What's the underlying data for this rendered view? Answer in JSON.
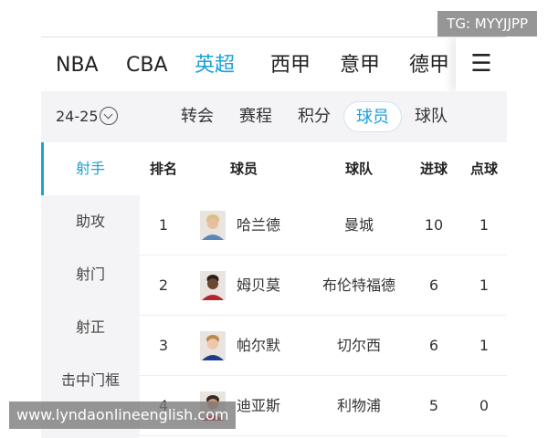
{
  "watermarks": {
    "top": "TG: MYYJJPP",
    "bottom": "www.lyndaonlineenglish.com"
  },
  "league_tabs": [
    {
      "label": "NBA"
    },
    {
      "label": "CBA"
    },
    {
      "label": "英超"
    },
    {
      "label": "西甲"
    },
    {
      "label": "意甲"
    },
    {
      "label": "德甲"
    }
  ],
  "active_league": "英超",
  "menu_icon": "hamburger-menu-icon",
  "season": {
    "label": "24-25",
    "icon": "chevron-down-circle-icon"
  },
  "sub_tabs": [
    {
      "label": "转会"
    },
    {
      "label": "赛程"
    },
    {
      "label": "积分"
    },
    {
      "label": "球员"
    },
    {
      "label": "球队"
    }
  ],
  "active_sub_tab": "球员",
  "categories": [
    {
      "label": "射手"
    },
    {
      "label": "助攻"
    },
    {
      "label": "射门"
    },
    {
      "label": "射正"
    },
    {
      "label": "击中门框"
    }
  ],
  "active_category": "射手",
  "table": {
    "headers": {
      "rank": "排名",
      "player": "球员",
      "team": "球队",
      "goals": "进球",
      "penalties": "点球"
    },
    "rows": [
      {
        "rank": "1",
        "player": "哈兰德",
        "team": "曼城",
        "goals": "10",
        "penalties": "1",
        "avatar": "player-avatar-icon"
      },
      {
        "rank": "2",
        "player": "姆贝莫",
        "team": "布伦特福德",
        "goals": "6",
        "penalties": "1",
        "avatar": "player-avatar-icon"
      },
      {
        "rank": "3",
        "player": "帕尔默",
        "team": "切尔西",
        "goals": "6",
        "penalties": "1",
        "avatar": "player-avatar-icon"
      },
      {
        "rank": "4",
        "player": "迪亚斯",
        "team": "利物浦",
        "goals": "5",
        "penalties": "0",
        "avatar": "player-avatar-icon"
      }
    ]
  },
  "colors": {
    "accent": "#1aa1d6",
    "panel_bg": "#f4f4f6"
  }
}
